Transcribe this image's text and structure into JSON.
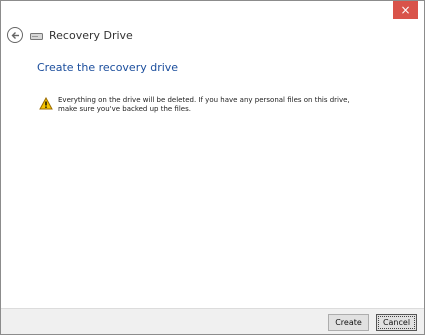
{
  "titlebar": {
    "close_glyph": "×",
    "close_color": "#d9534a"
  },
  "header": {
    "title": "Recovery Drive",
    "back_icon": "back-arrow-icon",
    "drive_icon": "drive-icon"
  },
  "main": {
    "heading": "Create the recovery drive",
    "warning_icon": "warning-icon",
    "warning_text": "Everything on the drive will be deleted. If you have any personal files on this drive, make sure you've backed up the files."
  },
  "footer": {
    "create_label": "Create",
    "cancel_label": "Cancel"
  },
  "colors": {
    "accent": "#1a4d9c",
    "warning": "#f5c400"
  }
}
